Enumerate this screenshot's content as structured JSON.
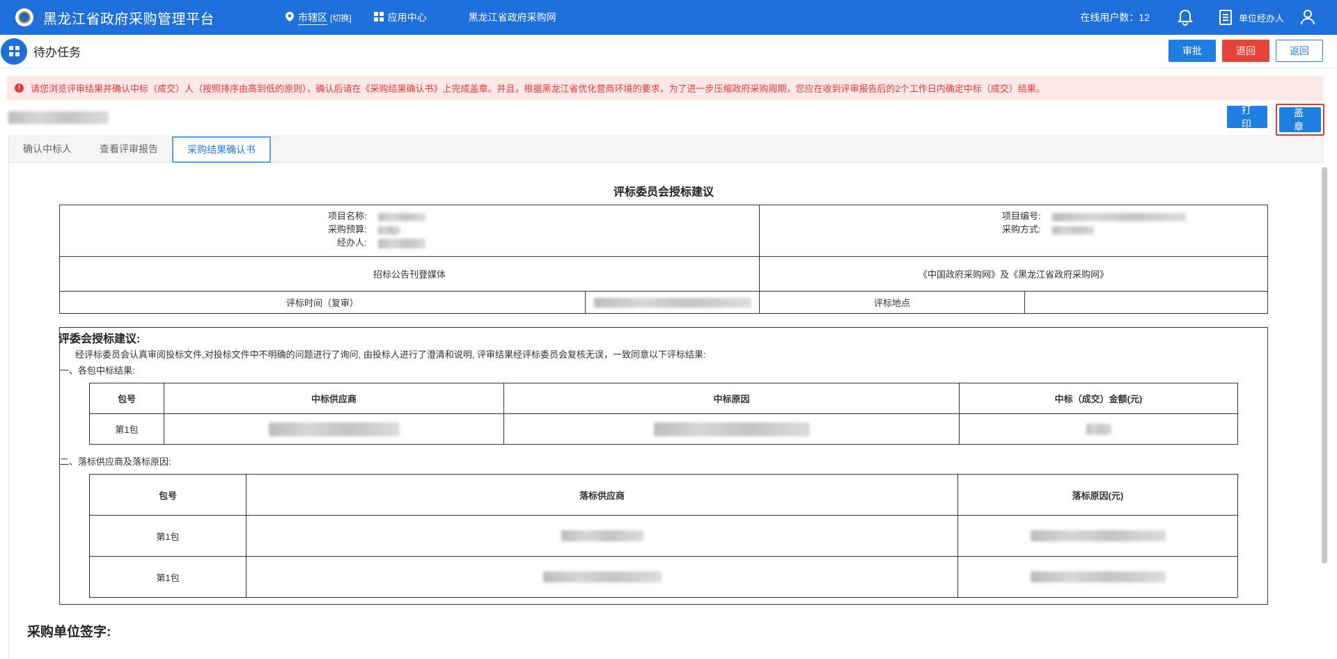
{
  "header": {
    "app_title": "黑龙江省政府采购管理平台",
    "district": "市辖区",
    "switch_label": "[切换]",
    "app_center": "应用中心",
    "gov_site": "黑龙江省政府采购网",
    "online_users": "在线用户数：12",
    "user_role": "单位经办人"
  },
  "page": {
    "title": "待办任务",
    "approve_label": "审批",
    "reject_label": "退回",
    "back_label": "返回",
    "alert": "请您浏览评审结果并确认中标（成交）人（按照排序由高到低的原则），确认后请在《采购结果确认书》上完成盖章。并且，根据黑龙江省优化营商环境的要求，为了进一步压缩政府采购周期，您应在收到评审报告后的2个工作日内确定中标（成交）结果。",
    "print_label": "打印",
    "stamp_label": "盖章"
  },
  "tabs": [
    {
      "label": "确认中标人"
    },
    {
      "label": "查看评审报告"
    },
    {
      "label": "采购结果确认书"
    }
  ],
  "doc": {
    "title": "评标委员会授标建议",
    "project_name_label": "项目名称:",
    "budget_label": "采购预算:",
    "handler_label": "经办人:",
    "project_no_label": "项目编号:",
    "method_label": "采购方式:",
    "media_label": "招标公告刊登媒体",
    "media_value": "《中国政府采购网》及《黑龙江省政府采购网》",
    "eval_time_label": "评标时间（复审）",
    "eval_place_label": "评标地点",
    "rec_title": "评委会授标建议:",
    "rec_text": "经评标委员会认真审阅投标文件,对投标文件中不明确的问题进行了询问, 由投标人进行了澄清和说明, 评审结果经评标委员会复核无误，一致同意以下评标结果:",
    "section1": "一、各包中标结果:",
    "win_headers": [
      "包号",
      "中标供应商",
      "中标原因",
      "中标（成交）金额(元)"
    ],
    "win_rows": [
      {
        "pkg": "第1包"
      }
    ],
    "section2": "二、落标供应商及落标原因:",
    "lose_headers": [
      "包号",
      "落标供应商",
      "落标原因(元)"
    ],
    "lose_rows": [
      {
        "pkg": "第1包"
      },
      {
        "pkg": "第1包"
      }
    ],
    "sign_label": "采购单位签字:"
  }
}
